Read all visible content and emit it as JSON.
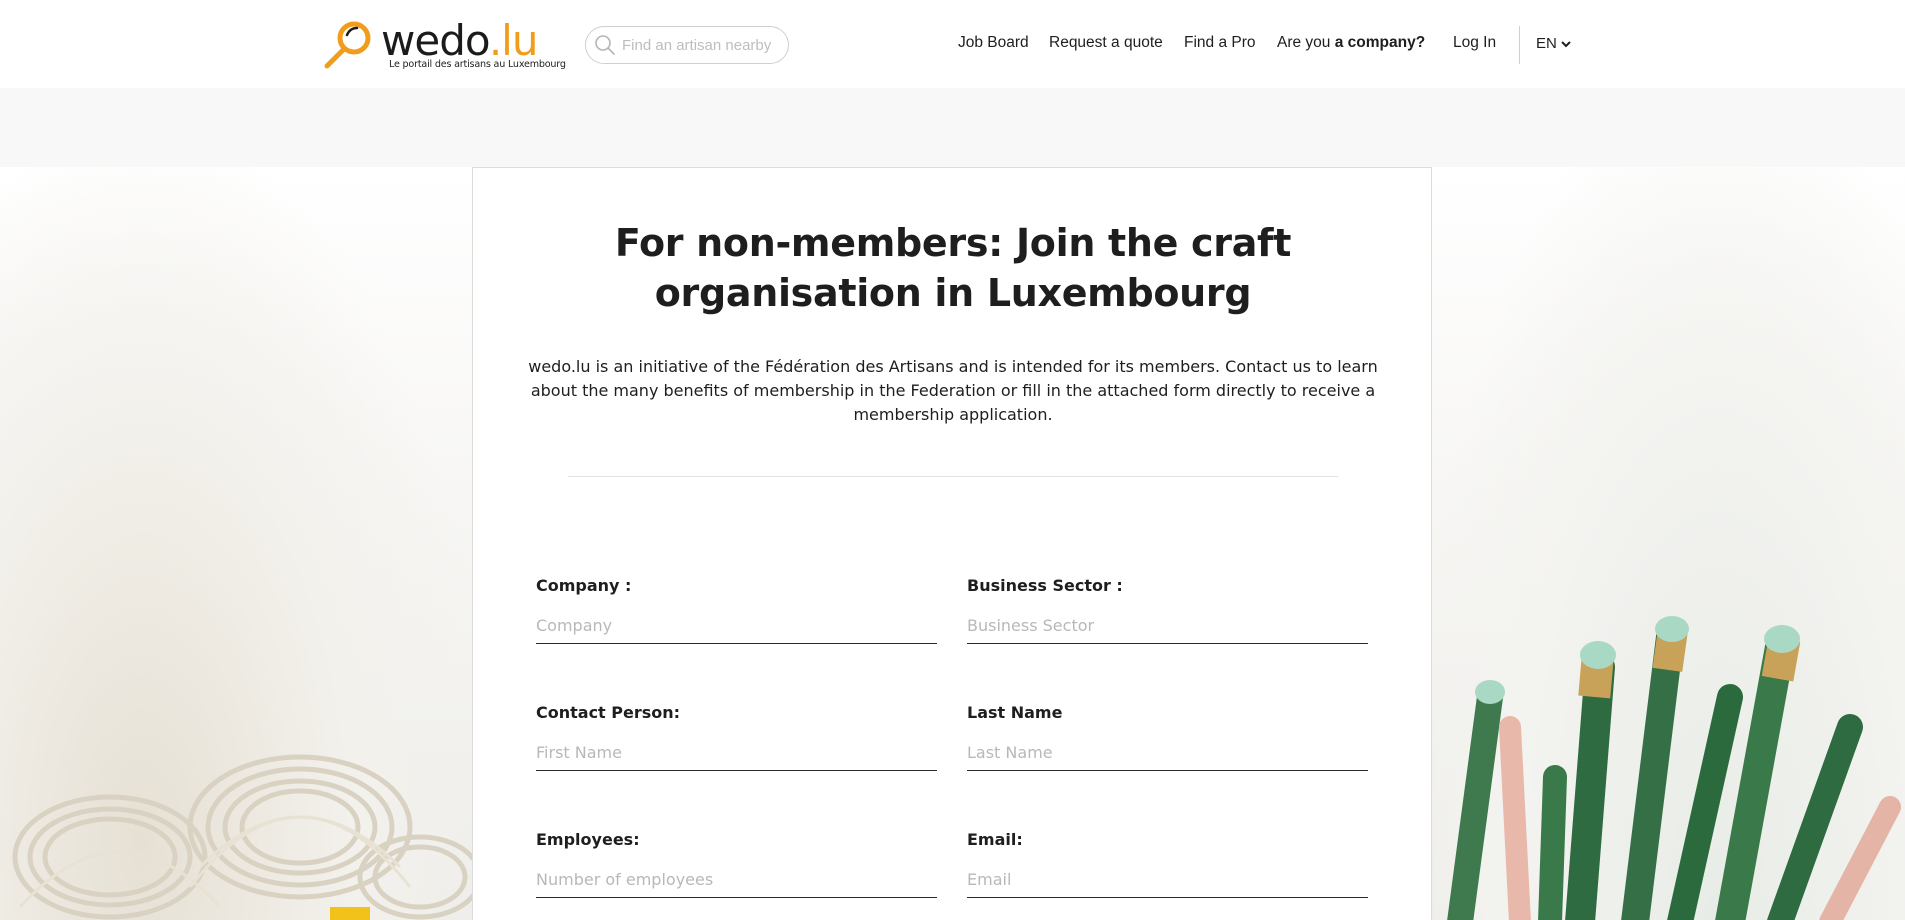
{
  "header": {
    "logo": {
      "word_part1": "wedo",
      "word_part2": ".lu",
      "tagline": "Le portail des artisans au Luxembourg"
    },
    "search": {
      "placeholder": "Find an artisan nearby"
    },
    "nav": {
      "job_board": "Job Board",
      "request_quote": "Request a quote",
      "find_pro": "Find a Pro",
      "company_prefix": "Are you",
      "company_bold": "a company?",
      "log_in": "Log In",
      "language": "EN"
    }
  },
  "main": {
    "title": "For non-members: Join the craft organisation in Luxembourg",
    "intro": "wedo.lu is an initiative of the Fédération des Artisans and is intended for its members. Contact us to learn about the many benefits of membership in the Federation or fill in the attached form directly to receive a membership application.",
    "form": {
      "company": {
        "label": "Company :",
        "placeholder": "Company"
      },
      "business_sector": {
        "label": "Business Sector :",
        "placeholder": "Business Sector"
      },
      "contact_person": {
        "label": "Contact Person:",
        "placeholder": "First Name"
      },
      "last_name": {
        "label": "Last Name",
        "placeholder": "Last Name"
      },
      "employees": {
        "label": "Employees:",
        "placeholder": "Number of employees"
      },
      "email": {
        "label": "Email:",
        "placeholder": "Email"
      }
    }
  },
  "colors": {
    "brand_orange": "#f29c1c",
    "text_dark": "#1e1e1e",
    "placeholder_gray": "#b8b8b8"
  }
}
